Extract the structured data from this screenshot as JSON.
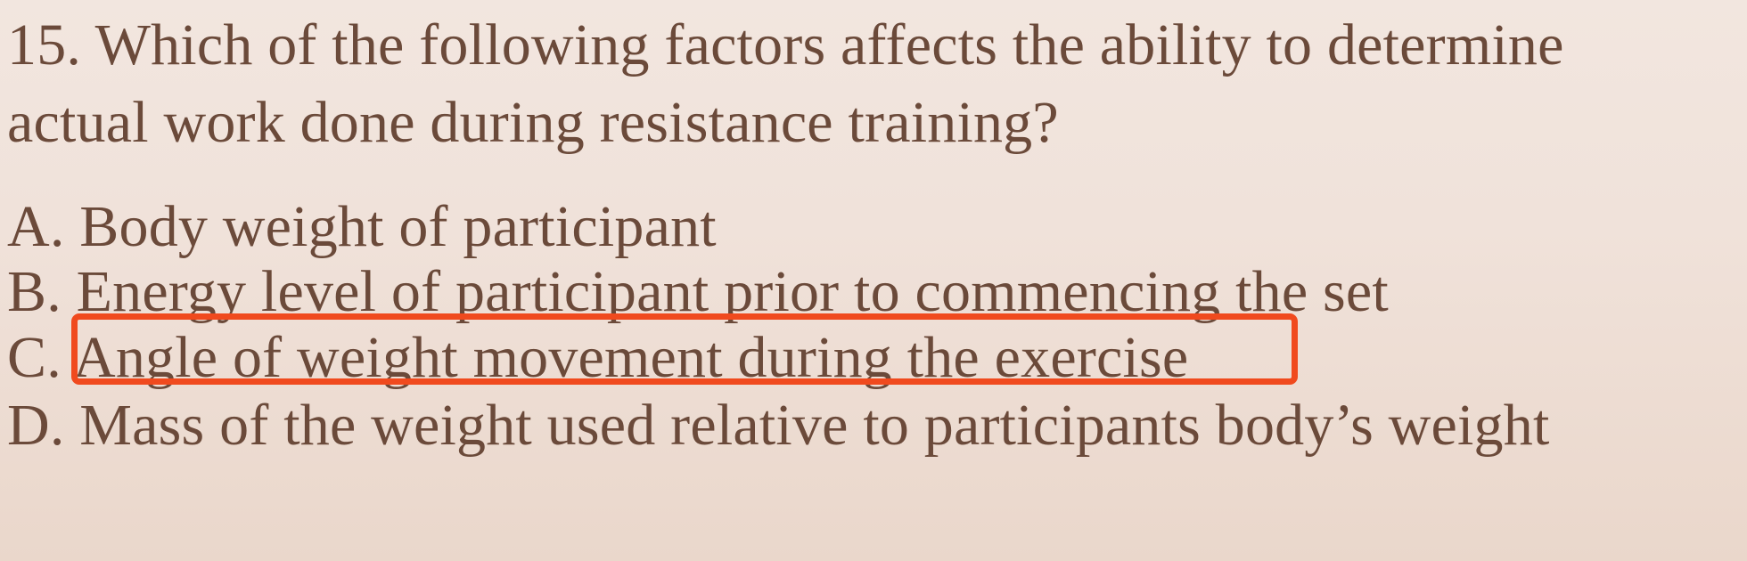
{
  "question": {
    "line1": "15. Which of the following factors affects the ability to determine",
    "line2": "actual work done during resistance training?"
  },
  "options": [
    {
      "letter": "A.",
      "text": " Body weight of participant"
    },
    {
      "letter": "B.",
      "text": " Energy level of participant prior to commencing the set"
    },
    {
      "letter": "C.",
      "text": " Angle of weight movement during the exercise"
    },
    {
      "letter": "D.",
      "text": " Mass of the weight used relative to participants body’s weight"
    }
  ],
  "highlight": {
    "selected_option": "C",
    "color": "#f04a1e"
  },
  "colors": {
    "text": "#6b4a3a",
    "background": "#f0e2da"
  }
}
